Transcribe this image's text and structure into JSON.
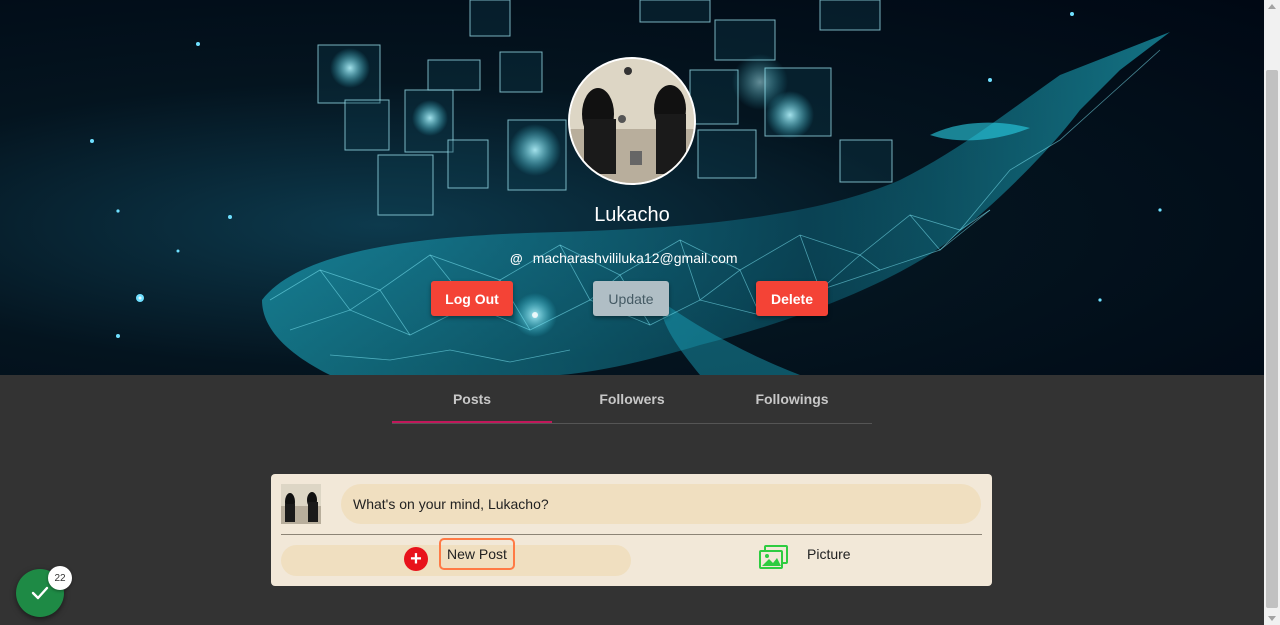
{
  "profile": {
    "username": "Lukacho",
    "email": "macharashvililuka12@gmail.com",
    "email_icon": "@"
  },
  "actions": {
    "logout_label": "Log Out",
    "update_label": "Update",
    "delete_label": "Delete"
  },
  "tabs": [
    {
      "label": "Posts",
      "active": true
    },
    {
      "label": "Followers",
      "active": false
    },
    {
      "label": "Followings",
      "active": false
    }
  ],
  "composer": {
    "placeholder": "What's on your mind, Lukacho?",
    "new_post_label": "New Post",
    "picture_label": "Picture",
    "plus_symbol": "+"
  },
  "notification": {
    "count": "22"
  },
  "colors": {
    "danger": "#f44336",
    "update": "#b0bec5",
    "tab_indicator": "#c2185b",
    "composer_bg": "#f2e8d8",
    "page_bg": "#333333",
    "fab": "#1e8a45",
    "picture_icon": "#2ecc40"
  },
  "icons": [
    "at-icon",
    "plus-icon",
    "image-icon",
    "check-icon"
  ]
}
